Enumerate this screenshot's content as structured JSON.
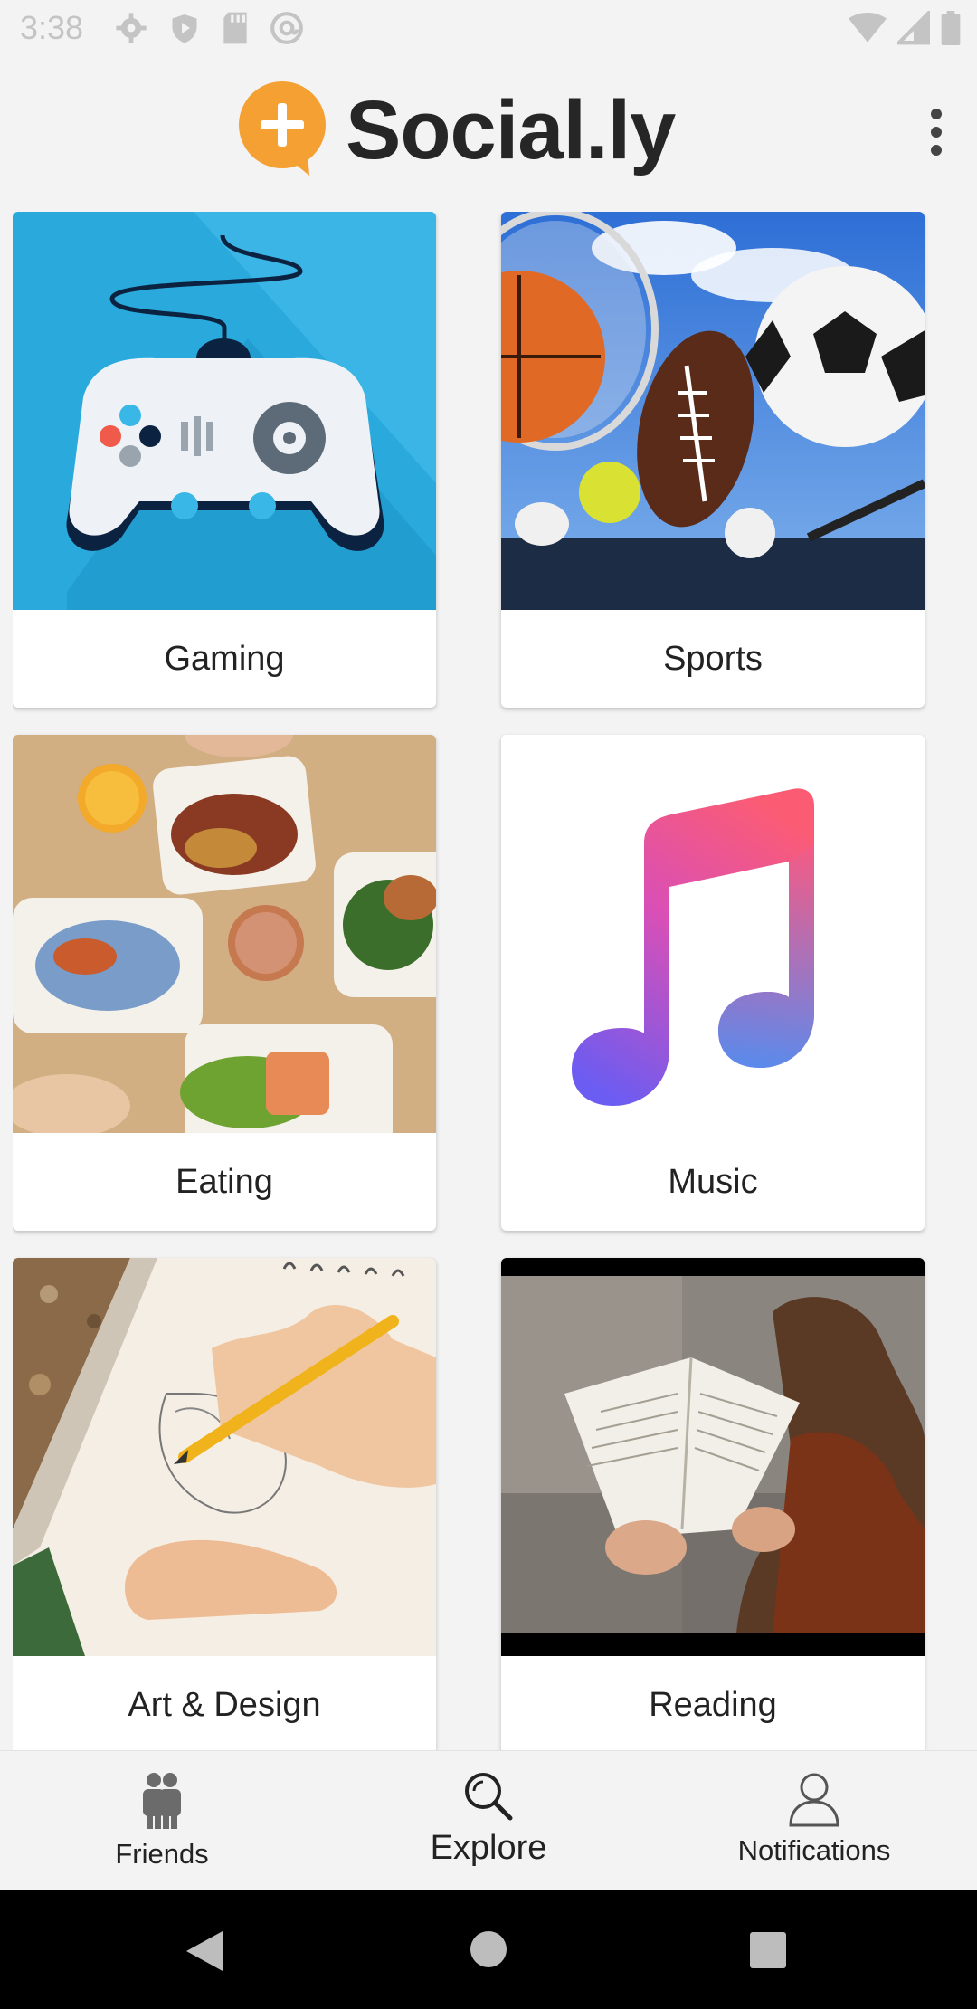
{
  "status_bar": {
    "time": "3:38",
    "icons": [
      "settings-gear-icon",
      "play-protect-icon",
      "sd-card-icon",
      "at-sign-icon",
      "wifi-icon",
      "cell-signal-icon",
      "battery-icon"
    ]
  },
  "app_bar": {
    "title": "Social.ly",
    "logo_icon": "plus-chat-bubble-icon",
    "menu_icon": "more-vertical-icon",
    "brand_color": "#f5a033"
  },
  "categories": [
    {
      "label": "Gaming",
      "image": "game-controller-image"
    },
    {
      "label": "Sports",
      "image": "sports-balls-image"
    },
    {
      "label": "Eating",
      "image": "food-table-image"
    },
    {
      "label": "Music",
      "image": "music-note-image"
    },
    {
      "label": "Art & Design",
      "image": "sketching-hand-image"
    },
    {
      "label": "Reading",
      "image": "reading-book-image"
    }
  ],
  "bottom_nav": {
    "items": [
      {
        "label": "Friends",
        "icon": "friends-icon",
        "active": false
      },
      {
        "label": "Explore",
        "icon": "explore-search-icon",
        "active": true
      },
      {
        "label": "Notifications",
        "icon": "person-outline-icon",
        "active": false
      }
    ]
  },
  "system_nav": {
    "back": "back-triangle-icon",
    "home": "home-circle-icon",
    "recents": "recents-square-icon"
  }
}
